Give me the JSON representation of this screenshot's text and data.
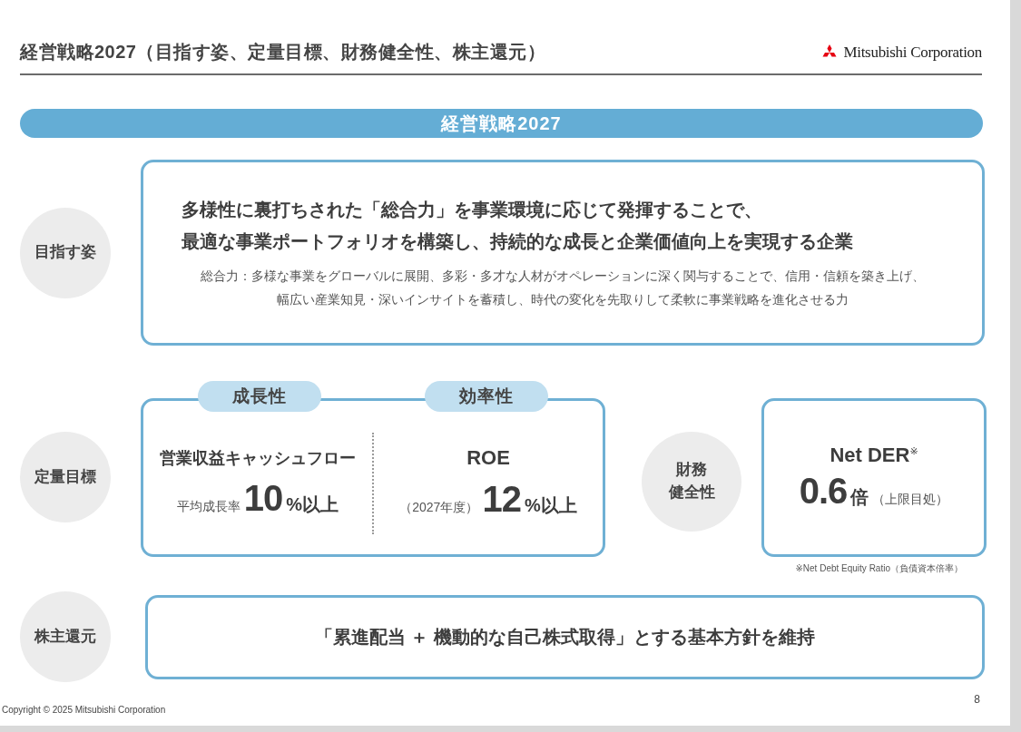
{
  "header": {
    "title": "経営戦略2027（目指す姿、定量目標、財務健全性、株主還元）",
    "logo_text": "Mitsubishi Corporation"
  },
  "banner": "経営戦略2027",
  "vision": {
    "label": "目指す姿",
    "lines": [
      "多様性に裏打ちされた「総合力」を事業環境に応じて発揮することで、",
      "最適な事業ポートフォリオを構築し、持続的な成長と企業価値向上を実現する企業"
    ],
    "note_lines": [
      "総合力：多様な事業をグローバルに展開、多彩・多才な人材がオペレーションに深く関与することで、信用・信頼を築き上げ、",
      "幅広い産業知見・深いインサイトを蓄積し、時代の変化を先取りして柔軟に事業戦略を進化させる力"
    ]
  },
  "targets": {
    "label": "定量目標",
    "metrics": [
      {
        "tag": "成長性",
        "name": "営業収益キャッシュフロー",
        "prefix": "平均成長率",
        "value": "10",
        "unit": "%以上"
      },
      {
        "tag": "効率性",
        "name": "ROE",
        "prefix": "（2027年度）",
        "value": "12",
        "unit": "%以上"
      }
    ]
  },
  "financial": {
    "label_lines": [
      "財務",
      "健全性"
    ],
    "name": "Net DER$^{※}$",
    "value": "0.6",
    "unit": "倍",
    "qualifier": "（上限目処）",
    "footnote": "※Net Debt Equity Ratio（負債資本倍率）"
  },
  "returns": {
    "label": "株主還元",
    "text": "「累進配当 ＋ 機動的な自己株式取得」とする基本方針を維持"
  },
  "footer": {
    "copyright": "Copyright © 2025 Mitsubishi Corporation",
    "page": "8"
  }
}
